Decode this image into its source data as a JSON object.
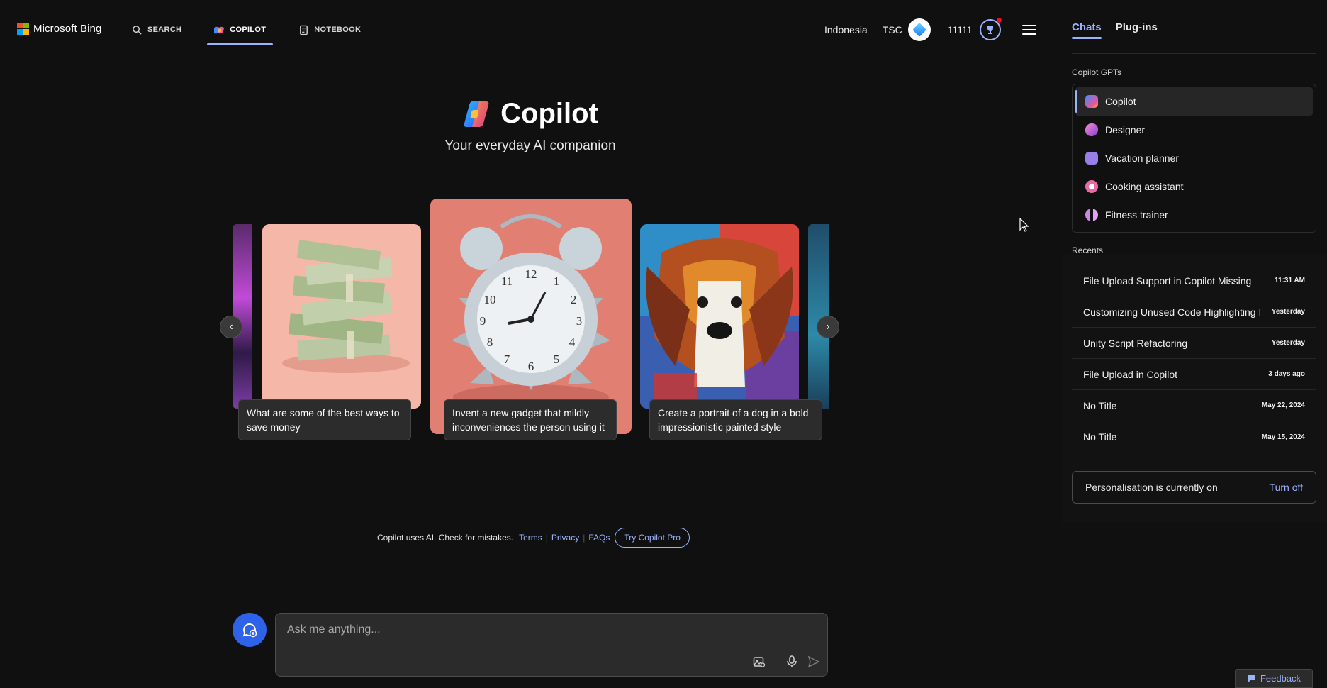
{
  "header": {
    "brand": "Microsoft Bing",
    "nav": [
      {
        "label": "SEARCH",
        "icon": "search-icon"
      },
      {
        "label": "COPILOT",
        "icon": "copilot-icon",
        "active": true
      },
      {
        "label": "NOTEBOOK",
        "icon": "notebook-icon"
      }
    ],
    "region": "Indonesia",
    "user_initials": "TSC",
    "rewards_points": "11111"
  },
  "hero": {
    "title": "Copilot",
    "subtitle": "Your everyday AI companion"
  },
  "carousel": {
    "cards": [
      {
        "caption": "What are some of the best ways to save money",
        "image": "stack-of-money"
      },
      {
        "caption": "Invent a new gadget that mildly inconveniences the person using it",
        "image": "spiked-alarm-clock"
      },
      {
        "caption": "Create a portrait of a dog in a bold impressionistic painted style",
        "image": "impressionist-dog"
      }
    ]
  },
  "footer": {
    "disclaimer": "Copilot uses AI. Check for mistakes.",
    "links": [
      "Terms",
      "Privacy",
      "FAQs"
    ],
    "pro_button": "Try Copilot Pro"
  },
  "composer": {
    "placeholder": "Ask me anything..."
  },
  "sidebar": {
    "tabs": [
      "Chats",
      "Plug-ins"
    ],
    "gpts_label": "Copilot GPTs",
    "gpts": [
      {
        "label": "Copilot",
        "color": "#3f8cff"
      },
      {
        "label": "Designer",
        "color": "#c04bd8"
      },
      {
        "label": "Vacation planner",
        "color": "#9a7ee8"
      },
      {
        "label": "Cooking assistant",
        "color": "#e86aa8"
      },
      {
        "label": "Fitness trainer",
        "color": "#c98ae0"
      }
    ],
    "recents_label": "Recents",
    "recents": [
      {
        "title": "File Upload Support in Copilot Missing",
        "time": "11:31 AM"
      },
      {
        "title": "Customizing Unused Code Highlighting I",
        "time": "Yesterday"
      },
      {
        "title": "Unity Script Refactoring",
        "time": "Yesterday"
      },
      {
        "title": "File Upload in Copilot",
        "time": "3 days ago"
      },
      {
        "title": "No Title",
        "time": "May 22, 2024"
      },
      {
        "title": "No Title",
        "time": "May 15, 2024"
      }
    ],
    "personalisation_text": "Personalisation is currently on",
    "personalisation_action": "Turn off"
  },
  "feedback_label": "Feedback",
  "colors": {
    "accent": "#9ab3ff",
    "background": "#101010",
    "new_topic": "#2e62e8"
  }
}
